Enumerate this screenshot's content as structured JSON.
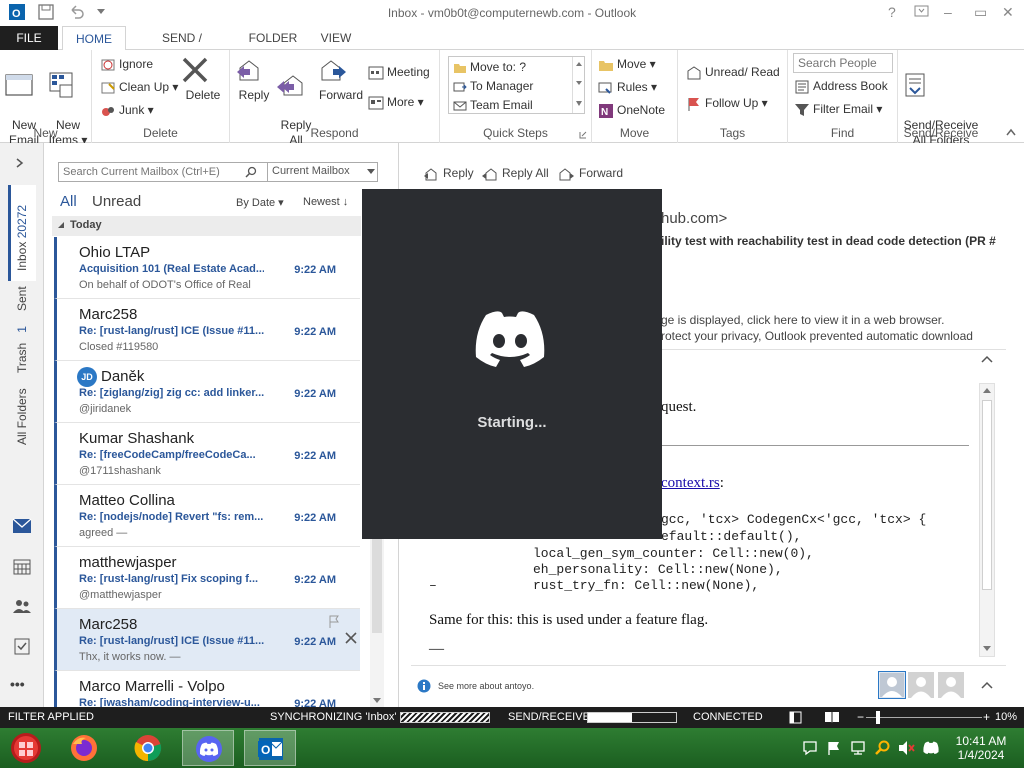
{
  "window": {
    "title": "Inbox - vm0b0t@computernewb.com - Outlook",
    "help": "?",
    "minimize": "–",
    "restore": "▭",
    "close": "✕"
  },
  "tabs": [
    {
      "label": "FILE"
    },
    {
      "label": "HOME"
    },
    {
      "label": "SEND / RECEIVE"
    },
    {
      "label": "FOLDER"
    },
    {
      "label": "VIEW"
    }
  ],
  "ribbon": {
    "new": {
      "new_email": "New\nEmail",
      "new_items": "New\nItems ▾",
      "label": "New"
    },
    "delete": {
      "ignore": "Ignore",
      "clean_up": "Clean Up ▾",
      "junk": "Junk ▾",
      "delete": "Delete",
      "label": "Delete"
    },
    "respond": {
      "reply": "Reply",
      "reply_all": "Reply\nAll",
      "forward": "Forward",
      "meeting": "Meeting",
      "more": "More ▾",
      "label": "Respond"
    },
    "quick_steps": {
      "items": [
        "Move to: ?",
        "To Manager",
        "Team Email"
      ],
      "label": "Quick Steps"
    },
    "move": {
      "move": "Move ▾",
      "rules": "Rules ▾",
      "onenote": "OneNote",
      "label": "Move"
    },
    "tags": {
      "unread_read": "Unread/ Read",
      "follow_up": "Follow Up ▾",
      "label": "Tags"
    },
    "find": {
      "search_people_placeholder": "Search People",
      "address_book": "Address Book",
      "filter_email": "Filter Email ▾",
      "label": "Find"
    },
    "send_receive": {
      "button": "Send/Receive\nAll Folders",
      "label": "Send/Receive"
    }
  },
  "leftnav": {
    "inbox": "Inbox",
    "inbox_count": "20272",
    "sent": "Sent",
    "trash": "Trash",
    "trash_count": "1",
    "all_folders": "All Folders",
    "more": "•••"
  },
  "list": {
    "search_placeholder": "Search Current Mailbox (Ctrl+E)",
    "scope": "Current Mailbox",
    "filter_all": "All",
    "filter_unread": "Unread",
    "sort_by": "By Date ▾",
    "order": "Newest ↓",
    "group": "Today",
    "items": [
      {
        "from": "Ohio LTAP",
        "subject": "Acquisition 101 (Real Estate Acad...",
        "time": "9:22 AM",
        "preview": "On behalf of ODOT's Office of Real"
      },
      {
        "from": "Marc258",
        "subject": "Re: [rust-lang/rust] ICE (Issue #11...",
        "time": "9:22 AM",
        "preview": "Closed #119580"
      },
      {
        "from": "Daněk",
        "subject": "Re: [ziglang/zig] zig cc: add linker...",
        "time": "9:22 AM",
        "preview": "@jiridanek",
        "avatar": "JD"
      },
      {
        "from": "Kumar Shashank",
        "subject": "Re: [freeCodeCamp/freeCodeCa...",
        "time": "9:22 AM",
        "preview": "@1711shashank"
      },
      {
        "from": "Matteo Collina",
        "subject": "Re: [nodejs/node] Revert \"fs: rem...",
        "time": "9:22 AM",
        "preview": "agreed —"
      },
      {
        "from": "matthewjasper",
        "subject": "Re: [rust-lang/rust] Fix scoping f...",
        "time": "9:22 AM",
        "preview": "@matthewjasper"
      },
      {
        "from": "Marc258",
        "subject": "Re: [rust-lang/rust] ICE (Issue #11...",
        "time": "9:22 AM",
        "preview": "Thx, it works now. —"
      },
      {
        "from": "Marco Marrelli - Volpo",
        "subject": "Re: [iwasham/coding-interview-u...",
        "time": "9:22 AM",
        "preview": ""
      }
    ]
  },
  "reading": {
    "reply": "Reply",
    "reply_all": "Reply All",
    "forward": "Forward",
    "sender_tail": "hub.com>",
    "subject_tail": "ility test with reachability test in dead code detection (PR #",
    "notice1": "ge is displayed, click here to view it in a web browser.",
    "notice2": "rotect your privacy, Outlook prevented automatic download",
    "body_request": "quest.",
    "body_link": "context.rs",
    "body_link_colon": ":",
    "code": [
      "gcc, 'tcx> CodegenCx<'gcc, 'tcx> {",
      "efault::default(),",
      "local_gen_sym_counter: Cell::new(0),",
      "eh_personality: Cell::new(None),",
      "rust_try_fn: Cell::new(None),"
    ],
    "body_text": "Same for this: this is used under a feature flag.",
    "body_dash": "—",
    "people_note": "See more about antoyo."
  },
  "splash": {
    "text": "Starting..."
  },
  "status": {
    "filter": "FILTER APPLIED",
    "sync": "SYNCHRONIZING 'Inbox'",
    "send_receive": "SEND/RECEIVE",
    "connected": "CONNECTED",
    "zoom": "10%",
    "send_receive_progress": 0.5
  },
  "taskbar": {
    "time": "10:41 AM",
    "date": "1/4/2024"
  },
  "colors": {
    "accent": "#2b579a",
    "discord_bg": "#2b2d31",
    "taskbar": "#2e7d32"
  }
}
